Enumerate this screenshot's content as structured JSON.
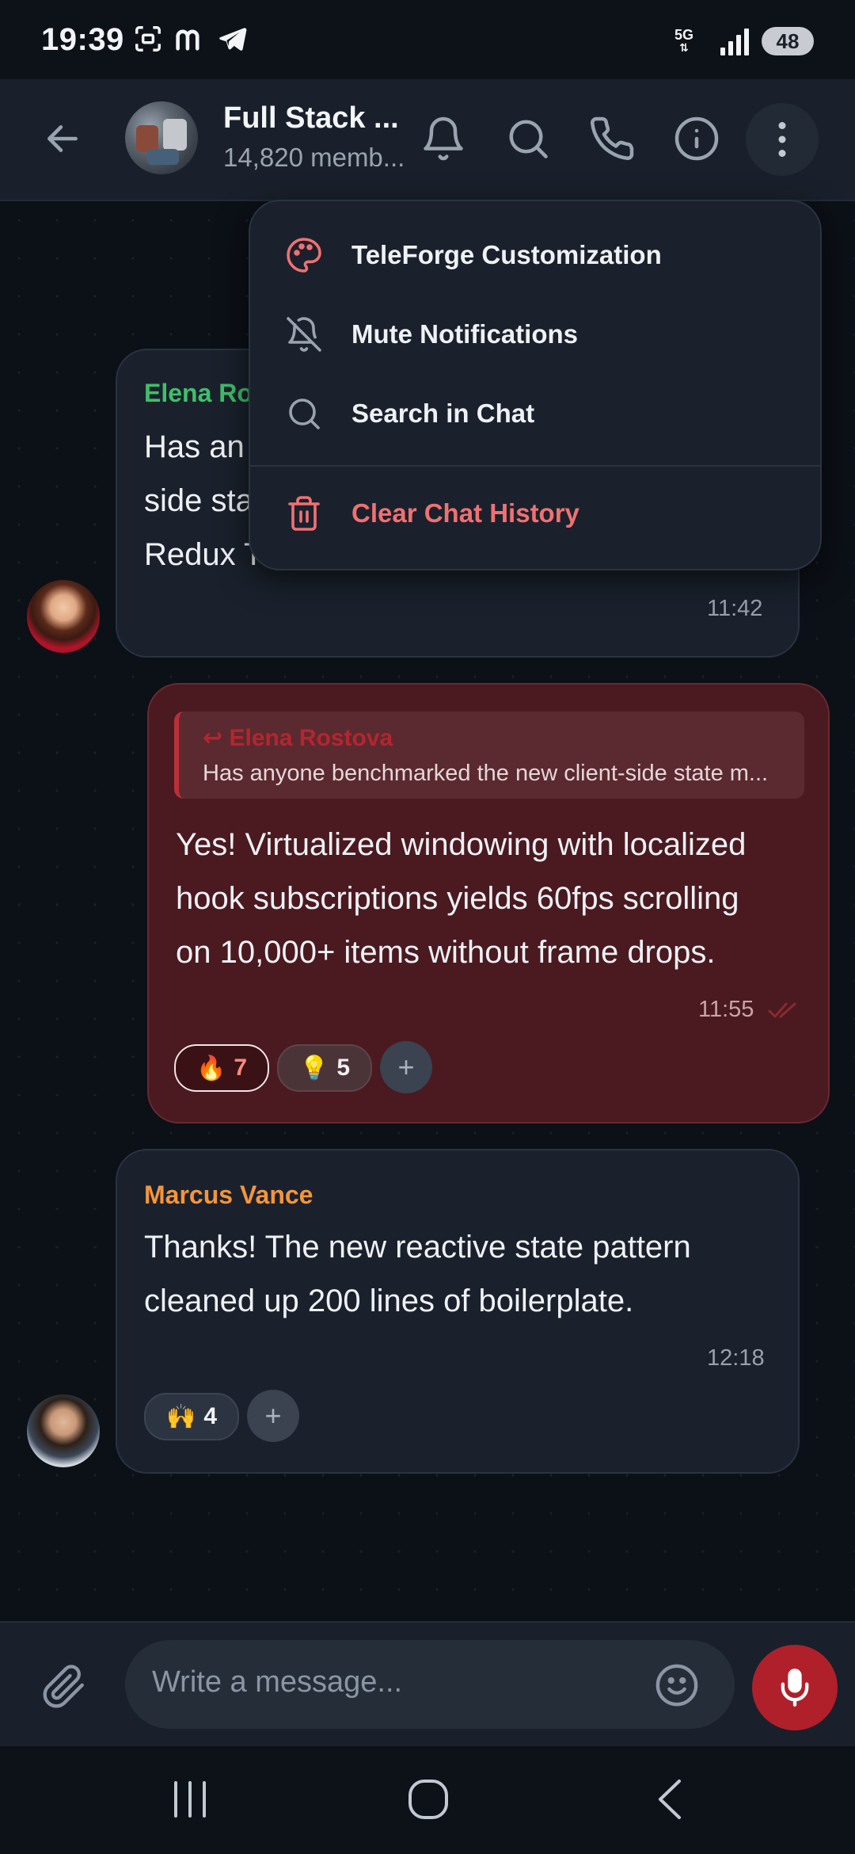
{
  "status_bar": {
    "time": "19:39",
    "network": "5G",
    "battery": "48",
    "icons": [
      "screenshot-icon",
      "m-app-icon",
      "telegram-icon",
      "signal-icon"
    ]
  },
  "header": {
    "title": "Full Stack ...",
    "subtitle": "14,820 memb...",
    "icons": [
      "back-arrow-icon",
      "bell-icon",
      "search-icon",
      "phone-icon",
      "info-icon",
      "more-vertical-icon"
    ]
  },
  "menu": {
    "items": [
      {
        "label": "TeleForge Customization",
        "icon": "palette-icon"
      },
      {
        "label": "Mute Notifications",
        "icon": "bell-off-icon"
      },
      {
        "label": "Search in Chat",
        "icon": "search-icon"
      },
      {
        "label": "Clear Chat History",
        "icon": "trash-icon",
        "danger": true
      }
    ]
  },
  "messages": [
    {
      "sender": "Elena Ro",
      "line1": "Has an",
      "line2": "side sta",
      "line3": "Redux T",
      "time": "11:42"
    },
    {
      "reply_to": {
        "name": "Elena Rostova",
        "text": "Has anyone benchmarked the new client-side state m..."
      },
      "line1": "Yes! Virtualized windowing with localized",
      "line2": "hook subscriptions yields 60fps scrolling",
      "line3": "on 10,000+ items without frame drops.",
      "time": "11:55",
      "reactions": [
        {
          "emoji": "🔥",
          "count": "7"
        },
        {
          "emoji": "💡",
          "count": "5"
        }
      ],
      "add_reaction": "+"
    },
    {
      "sender": "Marcus Vance",
      "line1": "Thanks! The new reactive state pattern",
      "line2": "cleaned up 200 lines of boilerplate.",
      "time": "12:18",
      "reactions": [
        {
          "emoji": "🙌",
          "count": "4"
        }
      ],
      "add_reaction": "+"
    }
  ],
  "composer": {
    "placeholder": "Write a message..."
  },
  "colors": {
    "accent": "#b0202a",
    "danger": "#f07172",
    "green_sender": "#3fbf6a",
    "orange_sender": "#f5953a"
  }
}
